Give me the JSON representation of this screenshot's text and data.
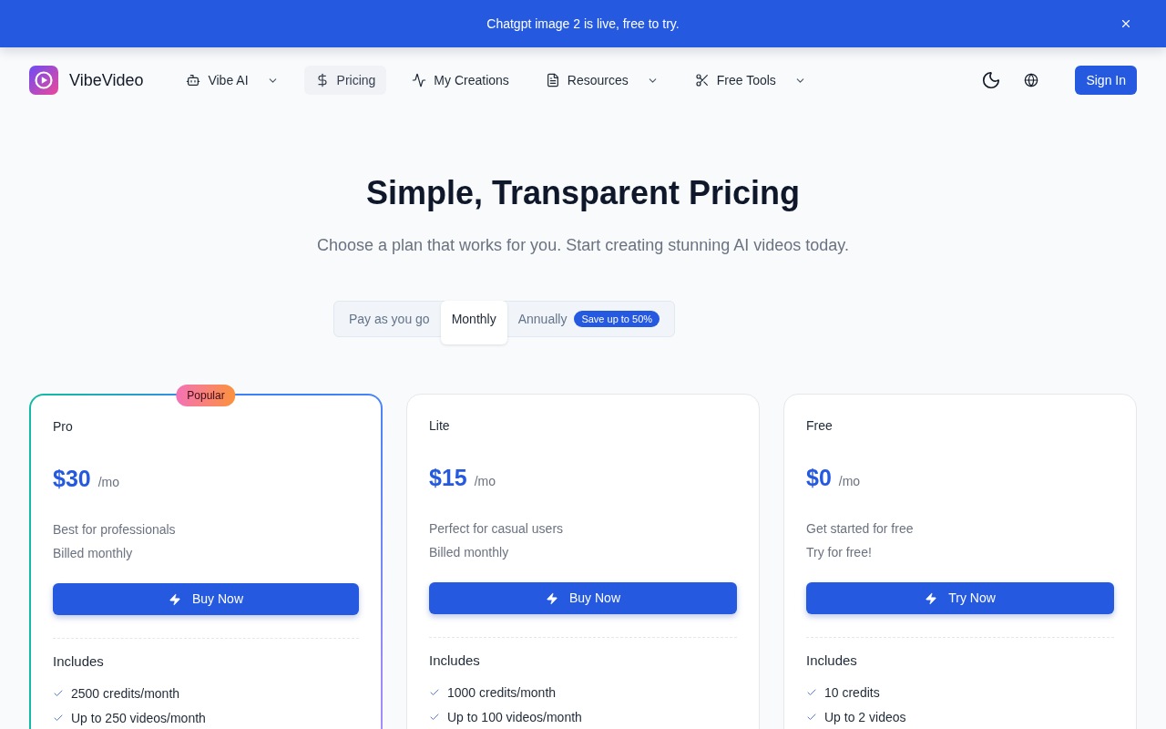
{
  "banner": {
    "text": "Chatgpt image 2 is live, free to try."
  },
  "header": {
    "brand": "VibeVideo",
    "nav": [
      {
        "label": "Vibe AI",
        "dropdown": true,
        "selected": false
      },
      {
        "label": "Pricing",
        "dropdown": false,
        "selected": true
      },
      {
        "label": "My Creations",
        "dropdown": false,
        "selected": false
      },
      {
        "label": "Resources",
        "dropdown": true,
        "selected": false
      },
      {
        "label": "Free Tools",
        "dropdown": true,
        "selected": false
      }
    ],
    "sign_in": "Sign In"
  },
  "hero": {
    "title": "Simple, Transparent Pricing",
    "subtitle": "Choose a plan that works for you. Start creating stunning AI videos today."
  },
  "billing_tabs": [
    {
      "label": "Pay as you go",
      "selected": false
    },
    {
      "label": "Monthly",
      "selected": true
    },
    {
      "label": "Annually",
      "selected": false,
      "badge": "Save up to 50%"
    }
  ],
  "plans": [
    {
      "name": "Pro",
      "badge": "Popular",
      "featured": true,
      "price": "$30",
      "period": "/mo",
      "description": "Best for professionals",
      "billing": "Billed monthly",
      "button": "Buy Now",
      "includes_title": "Includes",
      "features": [
        "2500 credits/month",
        "Up to 250 videos/month"
      ]
    },
    {
      "name": "Lite",
      "featured": false,
      "price": "$15",
      "period": "/mo",
      "description": "Perfect for casual users",
      "billing": "Billed monthly",
      "button": "Buy Now",
      "includes_title": "Includes",
      "features": [
        "1000 credits/month",
        "Up to 100 videos/month"
      ]
    },
    {
      "name": "Free",
      "featured": false,
      "price": "$0",
      "period": "/mo",
      "description": "Get started for free",
      "billing": "Try for free!",
      "button": "Try Now",
      "includes_title": "Includes",
      "features": [
        "10 credits",
        "Up to 2 videos"
      ]
    }
  ]
}
